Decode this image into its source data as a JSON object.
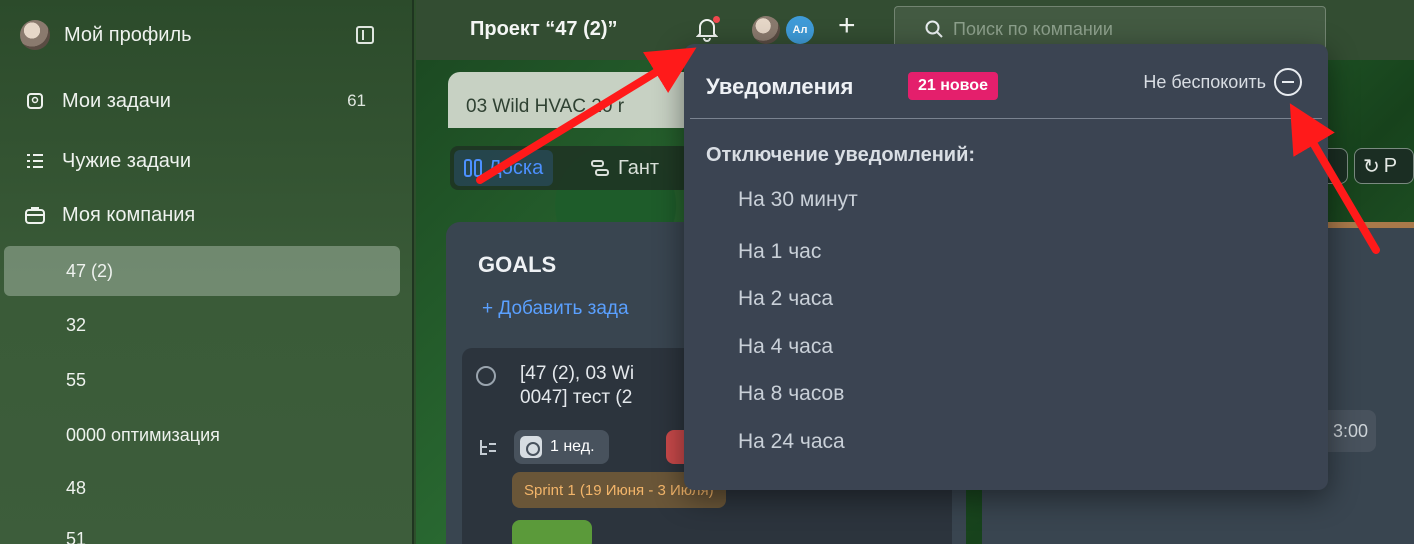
{
  "sidebar": {
    "profile_label": "Мой профиль",
    "items": [
      {
        "label": "Мои задачи",
        "count": "61"
      },
      {
        "label": "Чужие задачи"
      },
      {
        "label": "Моя компания"
      }
    ],
    "projects": [
      "47 (2)",
      "32",
      "55",
      "0000 оптимизация",
      "48",
      "51"
    ]
  },
  "topbar": {
    "project_title": "Проект “47 (2)”",
    "avatar_initials": "Ал",
    "add_label": "+",
    "search_placeholder": "Поиск по компании"
  },
  "board": {
    "tab_label": "03 Wild HVAC,20 r",
    "view_board": "Доска",
    "view_gantt": "Гант",
    "right_tool_label": "Р",
    "column_title": "GOALS",
    "add_task": "+ Добавить зада",
    "task_title_line1": "[47 (2), 03 Wi",
    "task_title_line2": "0047] тест (2",
    "estimate": "1 нед.",
    "sprint": "Sprint 1 (19 Июня - 3 Июля)",
    "right_chip": "3:00"
  },
  "notifications": {
    "title": "Уведомления",
    "new_badge": "21 новое",
    "dnd_label": "Не беспокоить",
    "mute_heading": "Отключение уведомлений:",
    "options": [
      "На 30 минут",
      "На 1 час",
      "На 2 часа",
      "На 4 часа",
      "На 8 часов",
      "На 24 часа"
    ]
  },
  "colors": {
    "accent_blue": "#4c90ff",
    "badge_pink": "#e41f6c",
    "arrow_red": "#ff1a1a",
    "sprint_orange": "#f3b56a"
  }
}
